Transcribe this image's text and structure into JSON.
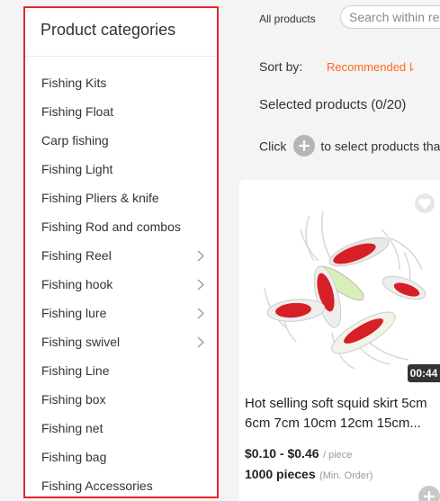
{
  "sidebar": {
    "title": "Product categories",
    "items": [
      {
        "label": "Fishing Kits",
        "has_sub": false
      },
      {
        "label": "Fishing Float",
        "has_sub": false
      },
      {
        "label": "Carp fishing",
        "has_sub": false
      },
      {
        "label": "Fishing Light",
        "has_sub": false
      },
      {
        "label": "Fishing Pliers & knife",
        "has_sub": false
      },
      {
        "label": "Fishing Rod and combos",
        "has_sub": false
      },
      {
        "label": "Fishing Reel",
        "has_sub": true
      },
      {
        "label": "Fishing hook",
        "has_sub": true
      },
      {
        "label": "Fishing lure",
        "has_sub": true
      },
      {
        "label": "Fishing swivel",
        "has_sub": true
      },
      {
        "label": "Fishing Line",
        "has_sub": false
      },
      {
        "label": "Fishing box",
        "has_sub": false
      },
      {
        "label": "Fishing net",
        "has_sub": false
      },
      {
        "label": "Fishing bag",
        "has_sub": false
      },
      {
        "label": "Fishing Accessories",
        "has_sub": false
      }
    ]
  },
  "header": {
    "all_products": "All products",
    "search_placeholder": "Search within res"
  },
  "sort": {
    "label": "Sort by:",
    "value": "Recommended⇂"
  },
  "selection": {
    "text": "Selected products (0/20)",
    "hint_prefix": "Click",
    "hint_suffix": "to select products tha"
  },
  "product": {
    "duration": "00:44",
    "title": "Hot selling soft squid skirt 5cm 6cm 7cm 10cm 12cm 15cm...",
    "price": "$0.10 - $0.46",
    "price_unit": "/ piece",
    "moq": "1000 pieces",
    "moq_label": "(Min. Order)"
  },
  "colors": {
    "highlight_border": "#e3262b",
    "sort_accent": "#ff6a1a"
  }
}
